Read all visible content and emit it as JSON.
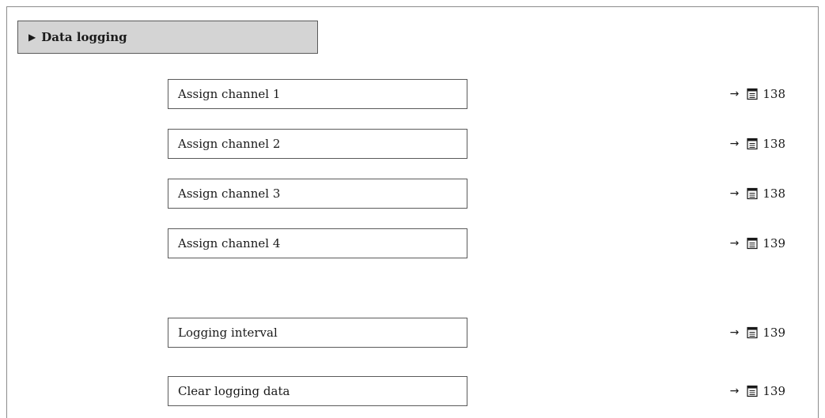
{
  "menu": {
    "title": "Data logging",
    "marker_icon": "triangle-right-icon"
  },
  "parameters": [
    {
      "label": "Assign channel 1",
      "arrow": "→",
      "page_icon": "book-icon",
      "page": "138"
    },
    {
      "label": "Assign channel 2",
      "arrow": "→",
      "page_icon": "book-icon",
      "page": "138"
    },
    {
      "label": "Assign channel 3",
      "arrow": "→",
      "page_icon": "book-icon",
      "page": "138"
    },
    {
      "label": "Assign channel 4",
      "arrow": "→",
      "page_icon": "book-icon",
      "page": "139"
    },
    {
      "label": "Logging interval",
      "arrow": "→",
      "page_icon": "book-icon",
      "page": "139"
    },
    {
      "label": "Clear logging data",
      "arrow": "→",
      "page_icon": "book-icon",
      "page": "139"
    }
  ],
  "colors": {
    "header_background": "#d4d4d4",
    "border": "#5a5a5a",
    "frame": "#8c8c8c"
  }
}
